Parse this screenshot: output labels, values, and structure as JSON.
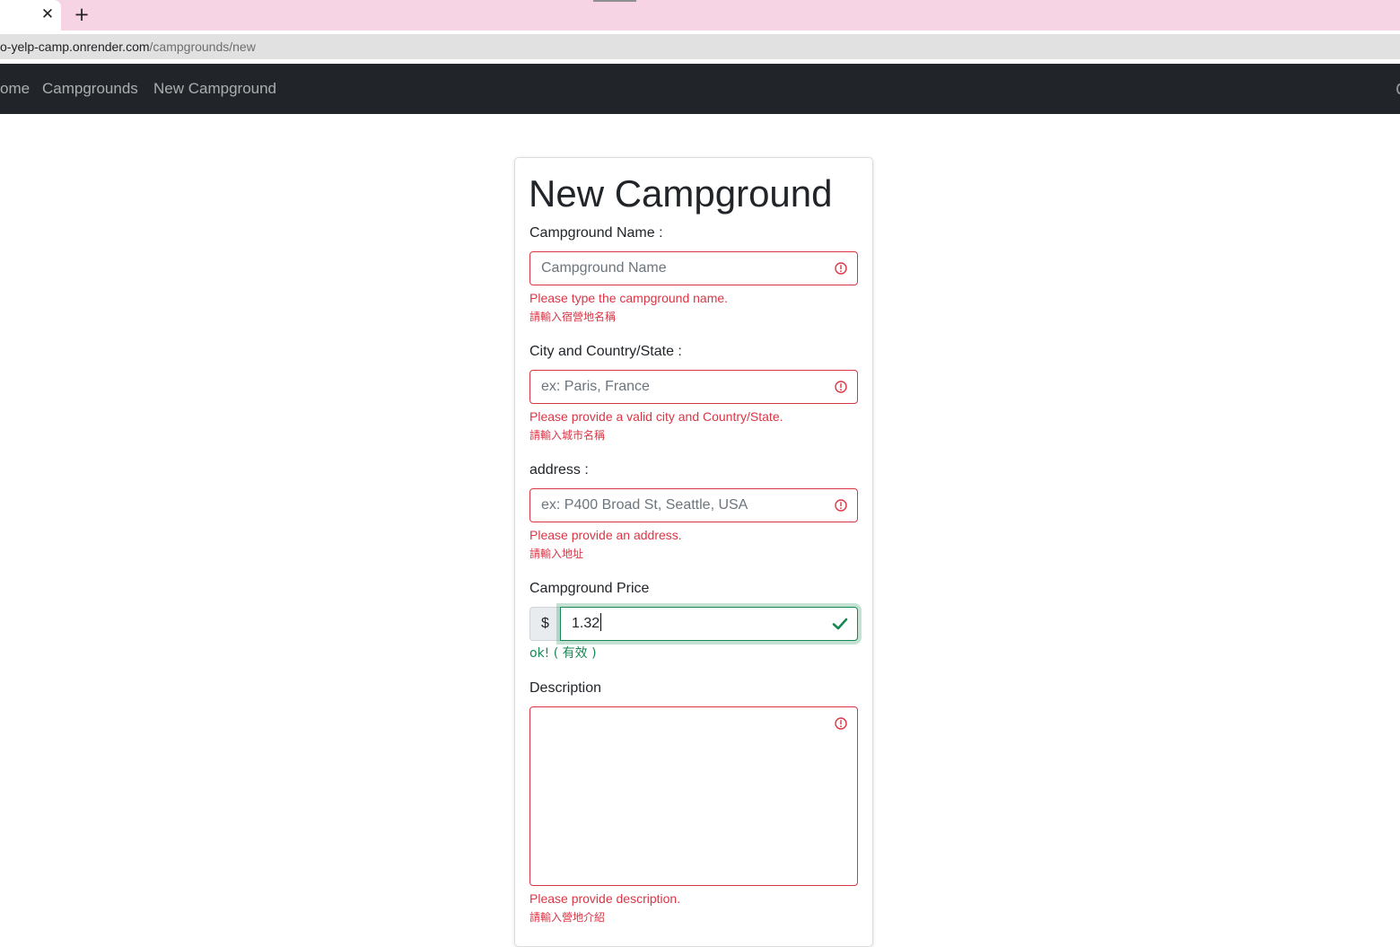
{
  "browser": {
    "tab_close_glyph": "✕",
    "new_tab_glyph": "+",
    "url_host": "o-yelp-camp.onrender.com",
    "url_path": "/campgrounds/new"
  },
  "navbar": {
    "home": "ome",
    "campgrounds": "Campgrounds",
    "new_campground": "New Campground"
  },
  "form": {
    "title": "New Campground",
    "name": {
      "label": "Campground Name :",
      "placeholder": "Campground Name",
      "error": "Please type the campground name.",
      "error_zh": "請輸入宿營地名稱"
    },
    "city": {
      "label": "City and Country/State :",
      "placeholder": "ex: Paris, France",
      "error": "Please provide a valid city and Country/State.",
      "error_zh": "請輸入城市名稱"
    },
    "address": {
      "label": "address :",
      "placeholder": "ex: P400 Broad St, Seattle, USA",
      "error": "Please provide an address.",
      "error_zh": "請輸入地址"
    },
    "price": {
      "label": "Campground Price",
      "currency": "$",
      "value": "1.32",
      "valid": "ok! ( 有效 )"
    },
    "description": {
      "label": "Description",
      "error": "Please provide description.",
      "error_zh": "請輸入營地介紹"
    }
  },
  "colors": {
    "invalid": "#dc3545",
    "valid": "#198754",
    "navbar": "#212529",
    "tabstrip": "#f6d4e3"
  },
  "icons": {
    "invalid": "exclamation-circle-icon",
    "valid": "check-icon",
    "close": "close-icon",
    "new_tab": "plus-icon"
  }
}
